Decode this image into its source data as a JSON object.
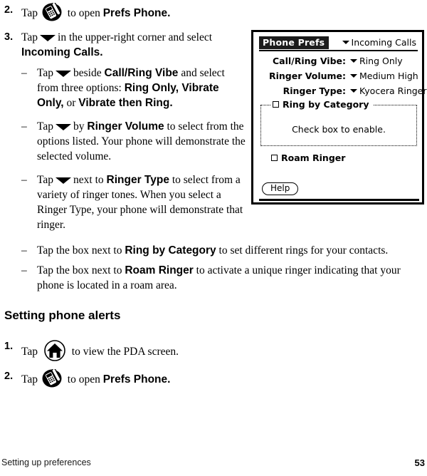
{
  "page": {
    "footer_left": "Setting up preferences",
    "footer_page_number": "53"
  },
  "instructions": {
    "step2_top": {
      "marker": "2.",
      "text_before_icon": "Tap",
      "icon": "phone-icon",
      "text_after_icon": "to open",
      "bold_tail": "Prefs Phone."
    },
    "step3": {
      "marker": "3.",
      "text_before_icon": "Tap",
      "icon": "caret-down-icon",
      "text_after_icon": "in the upper-right corner and select",
      "bold_tail": "Incoming Calls."
    },
    "sub_items": [
      {
        "dash": "–",
        "lead": "Tap",
        "icon": "caret-down-icon",
        "mid1": "beside",
        "bold1": "Call/Ring Vibe",
        "mid2": "and select from three options:",
        "bold2": "Ring Only, Vibrate Only,",
        "mid3": "or",
        "bold3": "Vibrate then Ring."
      },
      {
        "dash": "–",
        "lead": "Tap",
        "icon": "caret-down-icon",
        "mid1": "by",
        "bold1": "Ringer Volume",
        "mid2": "to select from the options listed. Your phone will demonstrate the selected volume."
      },
      {
        "dash": "–",
        "lead": "Tap",
        "icon": "caret-down-icon",
        "mid1": "next to",
        "bold1": "Ringer Type",
        "mid2": "to select from a variety of ringer tones. When you select a Ringer Type, your phone will demonstrate that ringer."
      },
      {
        "dash": "–",
        "lead": "Tap the box next to",
        "bold1": "Ring by Category",
        "mid2": "to set different rings for your contacts."
      },
      {
        "dash": "–",
        "lead": "Tap the box next to",
        "bold1": "Roam Ringer",
        "mid2": "to activate a unique ringer indicating that your phone is located in a roam area."
      }
    ],
    "section_heading": "Setting phone alerts",
    "step1_alerts": {
      "marker": "1.",
      "text_before_icon": "Tap",
      "icon": "home-icon",
      "text_after_icon": "to view the PDA screen."
    },
    "step2_alerts": {
      "marker": "2.",
      "text_before_icon": "Tap",
      "icon": "phone-icon",
      "text_after_icon": "to open",
      "bold_tail": "Prefs Phone."
    }
  },
  "pda_screen": {
    "title": "Phone Prefs",
    "category": "Incoming Calls",
    "category_icon": "caret-down-icon",
    "rows": [
      {
        "label": "Call/Ring Vibe:",
        "value": "Ring Only",
        "icon": "caret-down-icon"
      },
      {
        "label": "Ringer Volume:",
        "value": "Medium High",
        "icon": "caret-down-icon"
      },
      {
        "label": "Ringer Type:",
        "value": "Kyocera Ringer",
        "icon": "caret-down-icon"
      }
    ],
    "ring_by_category": {
      "label": "Ring by Category",
      "checked": false,
      "hint": "Check box to enable."
    },
    "roam_ringer": {
      "label": "Roam Ringer",
      "checked": false
    },
    "help_button": "Help"
  },
  "colors": {
    "ink": "#000000",
    "paper": "#ffffff",
    "titlebar_bg": "#1c1c1c",
    "titlebar_fg": "#ffffff"
  }
}
